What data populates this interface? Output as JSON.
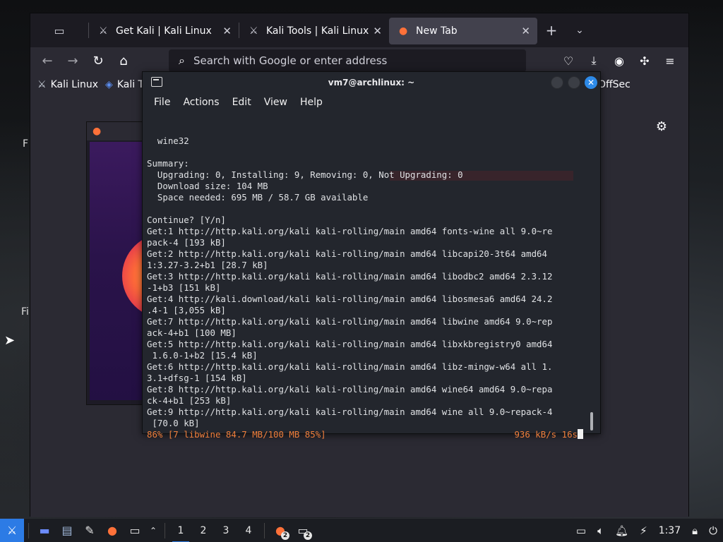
{
  "desktop": {
    "labels": [
      "F",
      "Fi"
    ]
  },
  "browser": {
    "tabs": [
      {
        "title": "Get Kali | Kali Linux",
        "icon": "kali-dragon-icon",
        "close": "✕"
      },
      {
        "title": "Kali Tools | Kali Linux To",
        "icon": "kali-dragon-icon",
        "close": "✕"
      },
      {
        "title": "New Tab",
        "icon": "firefox-icon",
        "close": "✕",
        "active": true
      }
    ],
    "new_tab": "+",
    "tab_list": "⌄",
    "address_placeholder": "Search with Google or enter address",
    "bookmarks": [
      {
        "label": "Kali Linux",
        "icon": "kali-dragon-icon"
      },
      {
        "label": "Kali T",
        "icon": "kali-tools-icon"
      }
    ],
    "bookmark_right": "OffSec"
  },
  "terminal": {
    "title": "vm7@archlinux: ~",
    "menu": [
      "File",
      "Actions",
      "Edit",
      "View",
      "Help"
    ],
    "lines": [
      "  wine32",
      "",
      "Summary:",
      "  Upgrading: 0, Installing: 9, Removing: 0, Not Upgrading: 0",
      "  Download size: 104 MB",
      "  Space needed: 695 MB / 58.7 GB available",
      "",
      "Continue? [Y/n]",
      "Get:1 http://http.kali.org/kali kali-rolling/main amd64 fonts-wine all 9.0~re",
      "pack-4 [193 kB]",
      "Get:2 http://http.kali.org/kali kali-rolling/main amd64 libcapi20-3t64 amd64",
      "1:3.27-3.2+b1 [28.7 kB]",
      "Get:3 http://http.kali.org/kali kali-rolling/main amd64 libodbc2 amd64 2.3.12",
      "-1+b3 [151 kB]",
      "Get:4 http://kali.download/kali kali-rolling/main amd64 libosmesa6 amd64 24.2",
      ".4-1 [3,055 kB]",
      "Get:7 http://http.kali.org/kali kali-rolling/main amd64 libwine amd64 9.0~rep",
      "ack-4+b1 [100 MB]",
      "Get:5 http://http.kali.org/kali kali-rolling/main amd64 libxkbregistry0 amd64",
      " 1.6.0-1+b2 [15.4 kB]",
      "Get:6 http://http.kali.org/kali kali-rolling/main amd64 libz-mingw-w64 all 1.",
      "3.1+dfsg-1 [154 kB]",
      "Get:8 http://http.kali.org/kali kali-rolling/main amd64 wine64 amd64 9.0~repa",
      "ck-4+b1 [253 kB]",
      "Get:9 http://http.kali.org/kali kali-rolling/main amd64 wine all 9.0~repack-4",
      " [70.0 kB]"
    ],
    "progress_left": "86% [7 libwine 84.7 MB/100 MB 85%]",
    "progress_right": "936 kB/s 16s"
  },
  "taskbar": {
    "workspaces": [
      "1",
      "2",
      "3",
      "4"
    ],
    "active_workspace": "1",
    "firefox_badge": "2",
    "terminal_badge": "2",
    "clock": "1:37"
  },
  "colors": {
    "accent": "#2c7be5",
    "progress": "#f07f3c"
  }
}
